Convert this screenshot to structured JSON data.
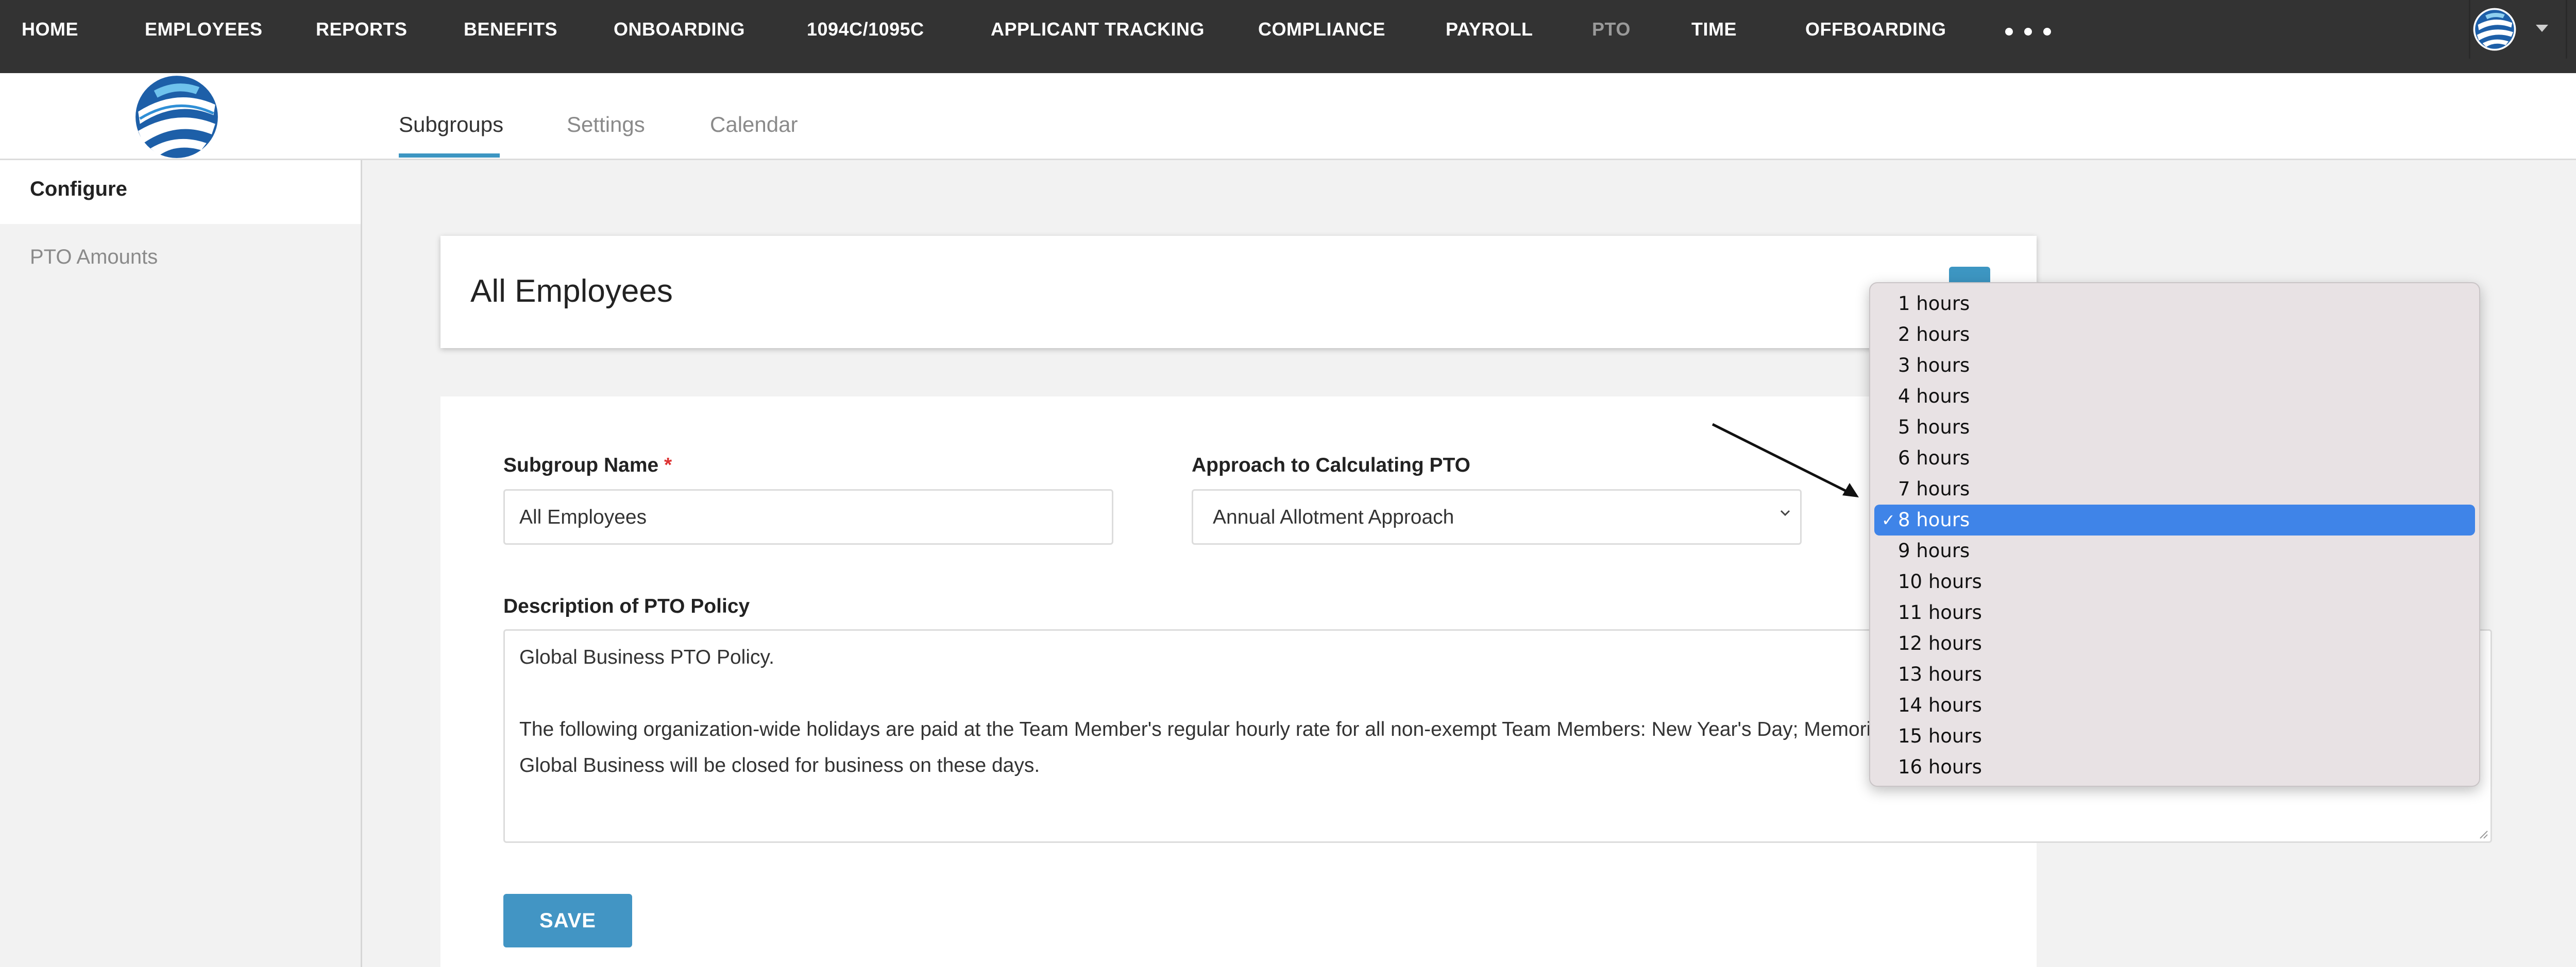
{
  "nav": {
    "items": [
      "HOME",
      "EMPLOYEES",
      "REPORTS",
      "BENEFITS",
      "ONBOARDING",
      "1094C/1095C",
      "APPLICANT TRACKING",
      "COMPLIANCE",
      "PAYROLL",
      "PTO",
      "TIME",
      "OFFBOARDING"
    ],
    "active": "PTO",
    "more_icon": "ellipsis-icon",
    "avatar_icon": "globe-logo-icon",
    "caret_icon": "caret-down-icon",
    "trash_icon": "trash-icon"
  },
  "subheader": {
    "logo_icon": "globe-logo-icon",
    "tabs": [
      "Subgroups",
      "Settings",
      "Calendar"
    ],
    "active_tab": "Subgroups"
  },
  "sidebar": {
    "heading": "Configure",
    "items": [
      "PTO Amounts"
    ]
  },
  "title_card": {
    "title": "All Employees"
  },
  "form": {
    "subgroup_name_label": "Subgroup Name",
    "required_mark": "*",
    "subgroup_name_value": "All Employees",
    "approach_label": "Approach to Calculating PTO",
    "approach_value": "Annual Allotment Approach",
    "description_label": "Description of PTO Policy",
    "description_lines": [
      "Global Business PTO Policy.",
      "",
      "The following organization-wide holidays are paid at the Team Member's regular hourly rate for all non-exempt Team Members: New Year's Day; Memorial",
      "Global Business will be closed for business on these days."
    ],
    "save_label": "SAVE"
  },
  "dropdown": {
    "options": [
      "1 hours",
      "2 hours",
      "3 hours",
      "4 hours",
      "5 hours",
      "6 hours",
      "7 hours",
      "8 hours",
      "9 hours",
      "10 hours",
      "11 hours",
      "12 hours",
      "13 hours",
      "14 hours",
      "15 hours",
      "16 hours"
    ],
    "selected": "8 hours",
    "check_mark": "✓"
  },
  "colors": {
    "nav_bg": "#333333",
    "accent": "#3d96c2",
    "selected_option": "#3f84e8",
    "required": "#dd3333"
  }
}
